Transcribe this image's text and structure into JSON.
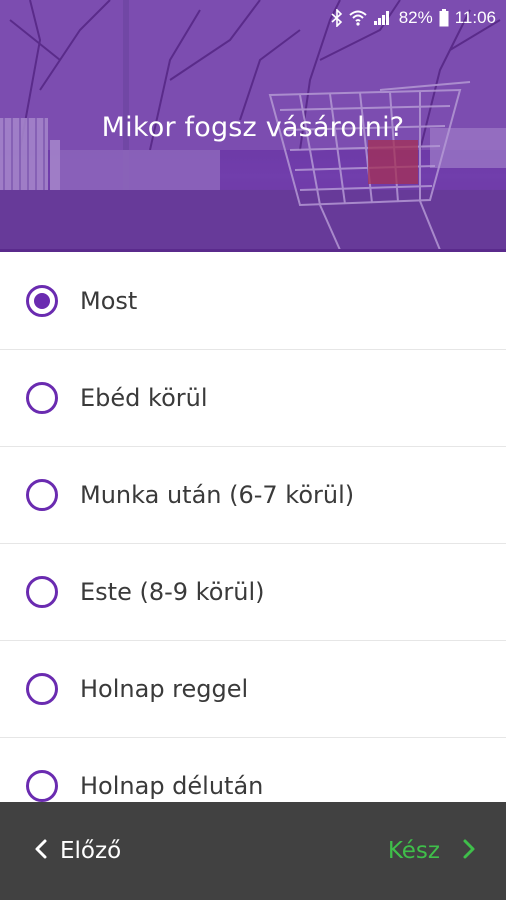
{
  "status_bar": {
    "battery_percent": "82%",
    "time": "11:06",
    "icons": [
      "bluetooth-icon",
      "wifi-icon",
      "signal-icon",
      "battery-icon"
    ]
  },
  "header": {
    "title": "Mikor fogsz vásárolni?"
  },
  "options": [
    {
      "label": "Most",
      "selected": true
    },
    {
      "label": "Ebéd körül",
      "selected": false
    },
    {
      "label": "Munka után (6-7 körül)",
      "selected": false
    },
    {
      "label": "Este (8-9 körül)",
      "selected": false
    },
    {
      "label": "Holnap reggel",
      "selected": false
    },
    {
      "label": "Holnap délután",
      "selected": false
    }
  ],
  "footer": {
    "prev_label": "Előző",
    "done_label": "Kész",
    "prev_icon": "chevron-left-icon",
    "done_icon": "chevron-right-icon"
  },
  "colors": {
    "accent": "#6a2bb0",
    "done_green": "#3fbf4a",
    "bottom_bar": "#414141"
  }
}
